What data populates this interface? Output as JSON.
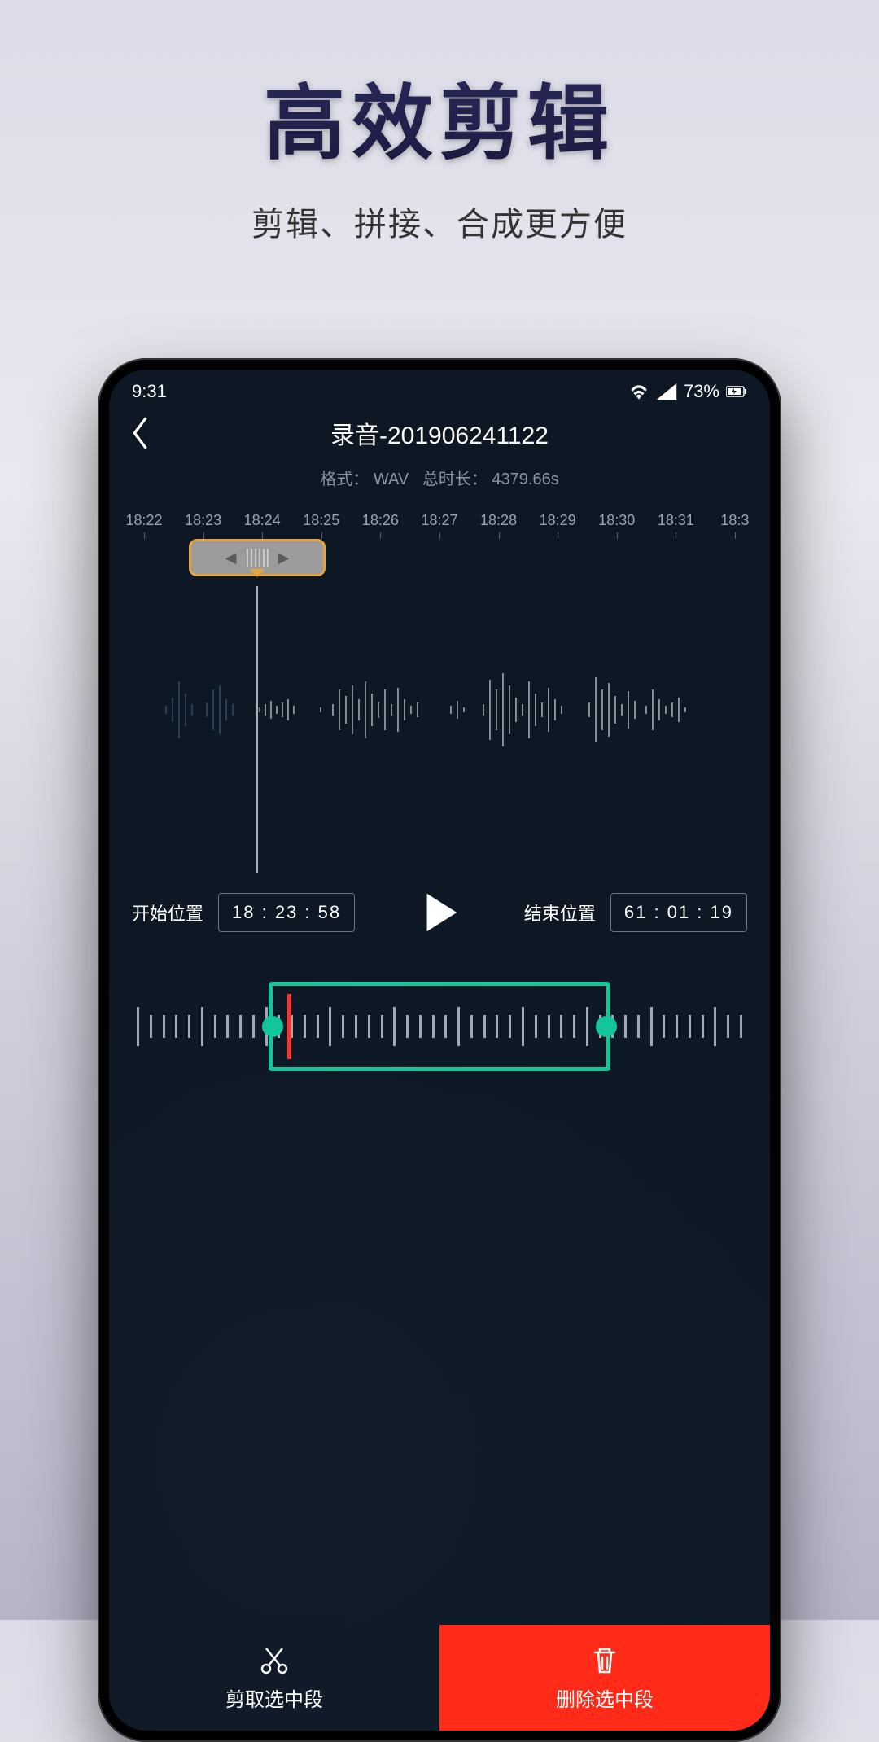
{
  "promo": {
    "title": "高效剪辑",
    "subtitle": "剪辑、拼接、合成更方便"
  },
  "statusbar": {
    "time": "9:31",
    "battery": "73%"
  },
  "nav": {
    "title": "录音-201906241122"
  },
  "meta": {
    "format_label": "格式：",
    "format": "WAV",
    "duration_label": "总时长：",
    "duration": "4379.66s"
  },
  "ruler": [
    "18:22",
    "18:23",
    "18:24",
    "18:25",
    "18:26",
    "18:27",
    "18:28",
    "18:29",
    "18:30",
    "18:31",
    "18:3"
  ],
  "controls": {
    "start_label": "开始位置",
    "start_value": "18 : 23 : 58",
    "end_label": "结束位置",
    "end_value": "61 : 01 : 19"
  },
  "actions": {
    "trim": "剪取选中段",
    "delete": "删除选中段"
  }
}
